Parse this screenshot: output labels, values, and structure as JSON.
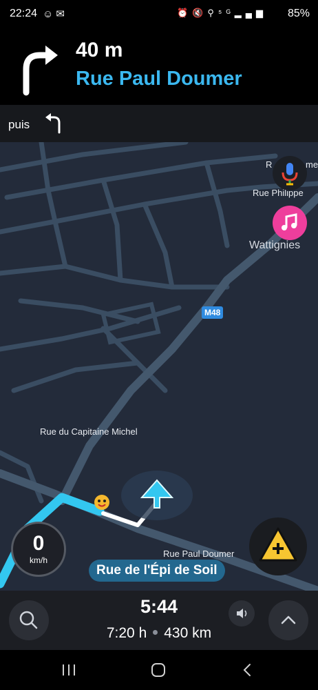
{
  "status_bar": {
    "time": "22:24",
    "left_icons": [
      "sticker-icon",
      "mail-icon"
    ],
    "right_icons": [
      "alarm-icon",
      "mute-icon",
      "location-icon",
      "5g-icon",
      "signal-icon"
    ],
    "battery": "85%"
  },
  "instruction": {
    "distance": "40 m",
    "street": "Rue Paul Doumer",
    "turn": "turn-right-icon"
  },
  "then": {
    "label": "puis",
    "turn": "turn-left-icon"
  },
  "map": {
    "labels": {
      "top_right_street": "Rue Philippe",
      "top_right_street_cut": "R",
      "top_right_street_end": "me",
      "town": "Wattignies",
      "capitaine": "Rue du Capitaine Michel",
      "paul_doumer": "Rue Paul Doumer"
    },
    "road_badge": "M48",
    "current_street": "Rue de l'Épi de Soil",
    "route_color": "#33c7f0",
    "background_color": "#232b3a"
  },
  "speed": {
    "value": "0",
    "unit": "km/h"
  },
  "trip": {
    "eta": "5:44",
    "duration": "7:20 h",
    "distance": "430 km"
  }
}
